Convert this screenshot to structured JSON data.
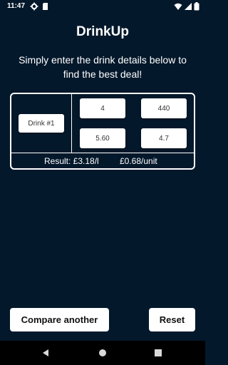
{
  "status_bar": {
    "time": "11:47",
    "icons_left": [
      "gear-icon",
      "sd-card-icon"
    ],
    "icons_right": [
      "wifi-icon",
      "signal-icon",
      "battery-icon"
    ]
  },
  "app": {
    "title": "DrinkUp",
    "subtitle": "Simply enter the drink details below to find the best deal!"
  },
  "drink": {
    "label": "Drink #1",
    "quantity": "4",
    "volume": "440",
    "price": "5.60",
    "abv": "4.7"
  },
  "result": {
    "per_litre": "Result: £3.18/l",
    "per_unit": "£0.68/unit"
  },
  "buttons": {
    "compare_another": "Compare another",
    "reset": "Reset"
  },
  "nav_bar": {
    "icons": [
      "back-icon",
      "home-icon",
      "recents-icon"
    ]
  },
  "colors": {
    "background": "#04182b",
    "card_border": "#ffffff",
    "button_bg": "#ffffff",
    "nav_bar": "#000000"
  }
}
